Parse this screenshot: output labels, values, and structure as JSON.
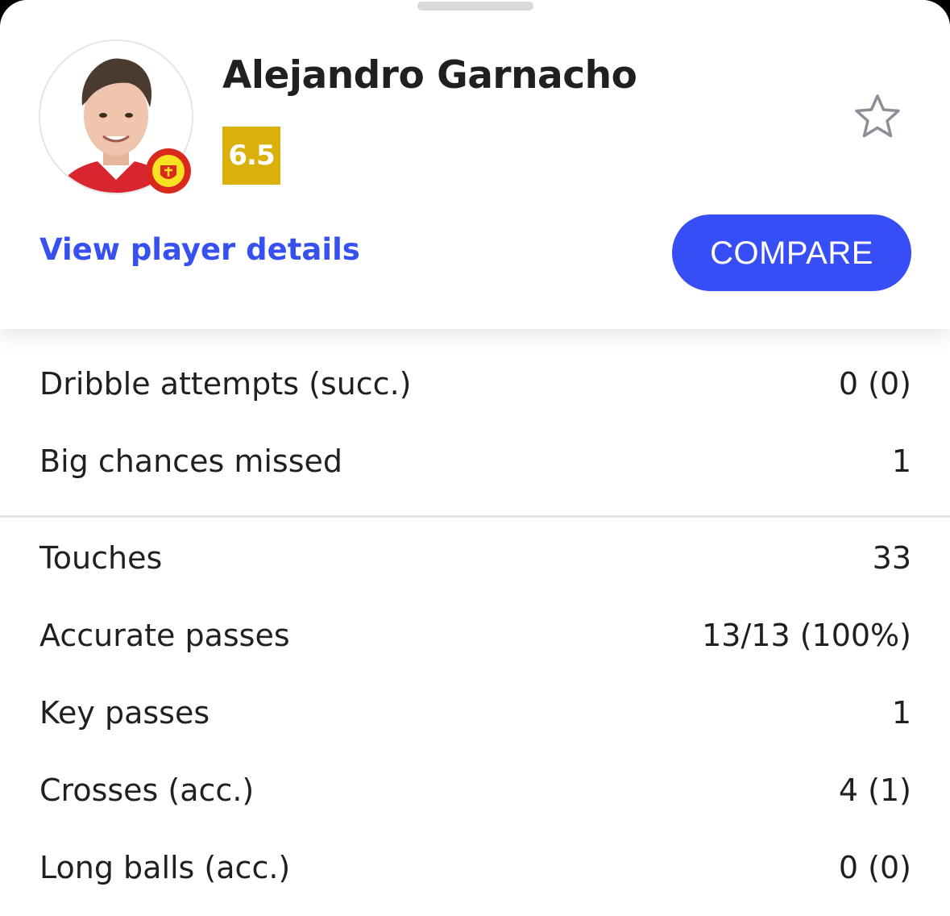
{
  "player": {
    "name": "Alejandro Garnacho",
    "rating": "6.5",
    "rating_color": "#d9b10a",
    "club_badge_text_top": "MANCHESTER",
    "club_badge_text_bottom": "UNITED"
  },
  "actions": {
    "view_details": "View player details",
    "compare": "COMPARE",
    "favorite_icon": "star-outline-icon",
    "accent_color": "#374df5"
  },
  "stats": {
    "group1": [
      {
        "label": "Dribble attempts (succ.)",
        "value": "0 (0)"
      },
      {
        "label": "Big chances missed",
        "value": "1"
      }
    ],
    "group2": [
      {
        "label": "Touches",
        "value": "33"
      },
      {
        "label": "Accurate passes",
        "value": "13/13 (100%)"
      },
      {
        "label": "Key passes",
        "value": "1"
      },
      {
        "label": "Crosses (acc.)",
        "value": "4 (1)"
      },
      {
        "label": "Long balls (acc.)",
        "value": "0 (0)"
      }
    ]
  }
}
